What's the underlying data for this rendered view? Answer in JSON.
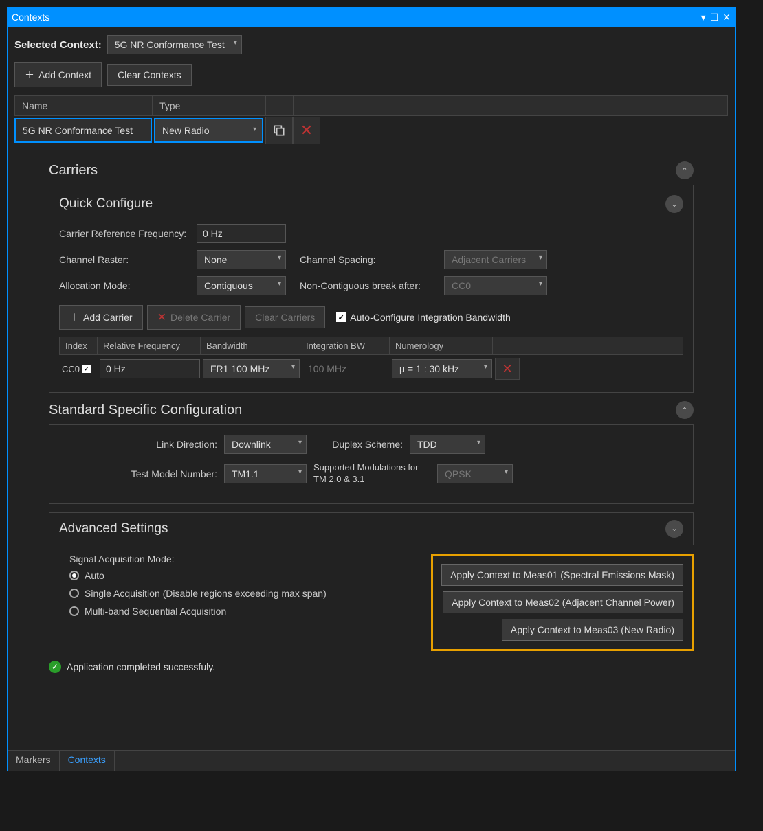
{
  "titlebar": {
    "title": "Contexts"
  },
  "selected": {
    "label": "Selected Context:",
    "value": "5G NR Conformance Test"
  },
  "toolbar": {
    "add": "Add Context",
    "clear": "Clear Contexts"
  },
  "table": {
    "headers": {
      "name": "Name",
      "type": "Type"
    },
    "row": {
      "name": "5G NR Conformance Test",
      "type": "New Radio"
    }
  },
  "carriers": {
    "title": "Carriers",
    "quick": {
      "title": "Quick Configure",
      "crf_label": "Carrier Reference Frequency:",
      "crf_value": "0 Hz",
      "raster_label": "Channel Raster:",
      "raster_value": "None",
      "spacing_label": "Channel Spacing:",
      "spacing_value": "Adjacent Carriers",
      "alloc_label": "Allocation Mode:",
      "alloc_value": "Contiguous",
      "break_label": "Non-Contiguous break after:",
      "break_value": "CC0"
    },
    "btns": {
      "add": "Add Carrier",
      "delete": "Delete Carrier",
      "clear": "Clear Carriers",
      "auto": "Auto-Configure Integration Bandwidth"
    },
    "ctable": {
      "headers": {
        "index": "Index",
        "relfreq": "Relative Frequency",
        "bw": "Bandwidth",
        "ibw": "Integration BW",
        "num": "Numerology"
      },
      "row": {
        "idx": "CC0",
        "relfreq": "0 Hz",
        "bw": "FR1 100 MHz",
        "ibw": "100 MHz",
        "num": "μ = 1 : 30 kHz"
      }
    }
  },
  "std": {
    "title": "Standard Specific Configuration",
    "link_label": "Link Direction:",
    "link_value": "Downlink",
    "duplex_label": "Duplex Scheme:",
    "duplex_value": "TDD",
    "tm_label": "Test Model Number:",
    "tm_value": "TM1.1",
    "mod_label": "Supported Modulations for TM 2.0 & 3.1",
    "mod_value": "QPSK"
  },
  "advanced": {
    "title": "Advanced Settings"
  },
  "signal": {
    "label": "Signal Acquisition Mode:",
    "opt1": "Auto",
    "opt2": "Single Acquisition (Disable regions exceeding max span)",
    "opt3": "Multi-band Sequential Acquisition"
  },
  "apply": {
    "b1": "Apply Context to Meas01 (Spectral Emissions Mask)",
    "b2": "Apply Context to Meas02 (Adjacent Channel Power)",
    "b3": "Apply Context to Meas03 (New Radio)"
  },
  "status": "Application completed successfuly.",
  "tabs": {
    "markers": "Markers",
    "contexts": "Contexts"
  }
}
